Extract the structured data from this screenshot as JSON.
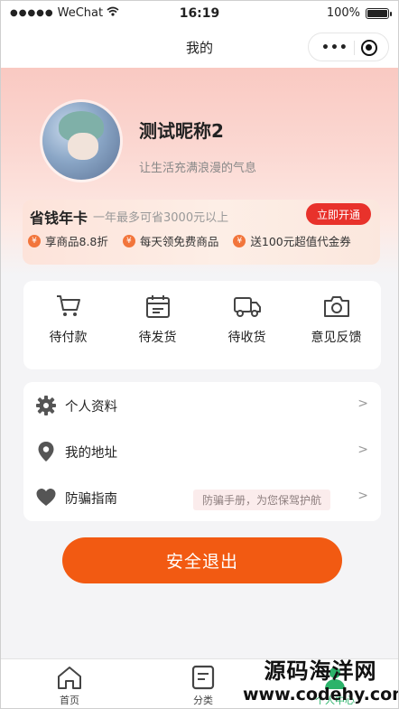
{
  "status_bar": {
    "carrier": "WeChat",
    "time": "16:19",
    "battery": "100%"
  },
  "navbar": {
    "title": "我的"
  },
  "profile": {
    "nickname": "测试昵称2",
    "bio": "让生活充满浪漫的气息"
  },
  "saving_card": {
    "title": "省钱年卡",
    "subtitle": "一年最多可省3000元以上",
    "button": "立即开通",
    "perks": [
      "享商品8.8折",
      "每天领免费商品",
      "送100元超值代金券"
    ]
  },
  "orders": [
    {
      "label": "待付款",
      "icon": "cart-icon"
    },
    {
      "label": "待发货",
      "icon": "calendar-icon"
    },
    {
      "label": "待收货",
      "icon": "truck-icon"
    },
    {
      "label": "意见反馈",
      "icon": "camera-icon"
    }
  ],
  "settings": [
    {
      "label": "个人资料",
      "icon": "gear-icon",
      "arrow": ">"
    },
    {
      "label": "我的地址",
      "icon": "location-pin-icon",
      "arrow": ">"
    },
    {
      "label": "防骗指南",
      "icon": "heart-icon",
      "arrow": ">",
      "tag": "防骗手册，为您保驾护航"
    }
  ],
  "logout_button": "安全退出",
  "tabbar": [
    {
      "label": "首页",
      "icon": "home-icon"
    },
    {
      "label": "分类",
      "icon": "category-icon"
    },
    {
      "label": "个人中心",
      "icon": "user-icon"
    }
  ],
  "watermark": {
    "line1": "源码海洋网",
    "line2": "www.codehy.com"
  },
  "colors": {
    "accent": "#f25a12",
    "open_button": "#e8322b",
    "header_pink": "#f9c9c2"
  }
}
